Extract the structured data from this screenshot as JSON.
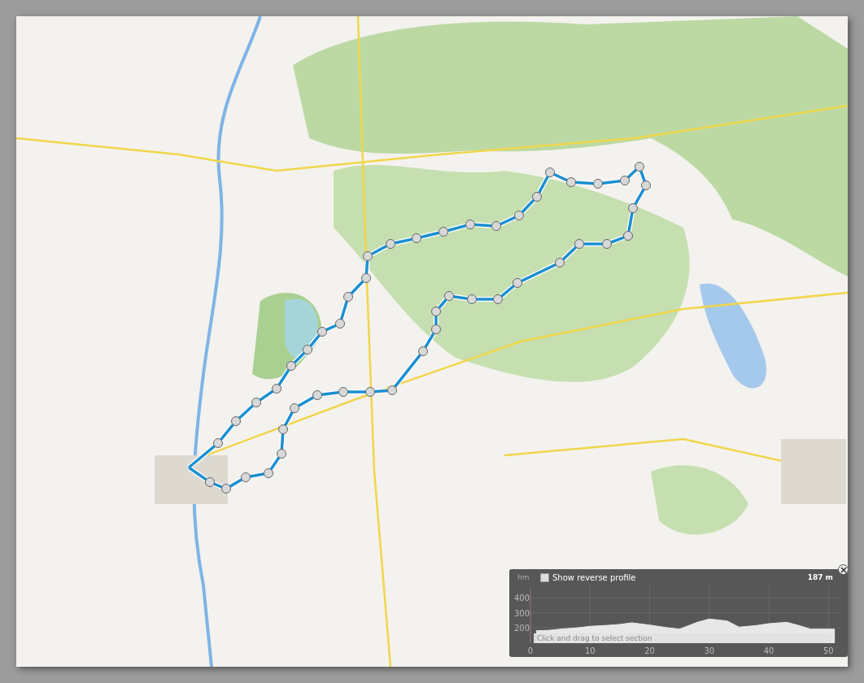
{
  "map": {
    "profile": {
      "show_reverse": {
        "label": "Show reverse profile",
        "checked": false
      },
      "elevation_reading": "187 m",
      "unit_label": "hm",
      "hint": "Click and drag to select section",
      "chart_data": {
        "type": "area",
        "grid": true,
        "x": [
          1,
          3,
          5,
          8,
          10,
          13,
          15,
          17,
          20,
          23,
          25,
          28,
          30,
          33,
          35,
          38,
          40,
          43,
          45,
          47,
          50,
          51
        ],
        "series": [
          {
            "color": "#e8e8e8",
            "values": [
              180,
              182,
              191,
              200,
              209,
              216,
              222,
              233,
              218,
              200,
              191,
              236,
              258,
              245,
              204,
              215,
              227,
              236,
              215,
              191,
              191,
              190
            ]
          }
        ],
        "xlim": [
          0,
          52
        ],
        "ylim": [
          100,
          450
        ],
        "xticks": [
          0,
          10,
          20,
          30,
          40,
          50
        ],
        "yticks": [
          200,
          300,
          400
        ]
      }
    }
  }
}
